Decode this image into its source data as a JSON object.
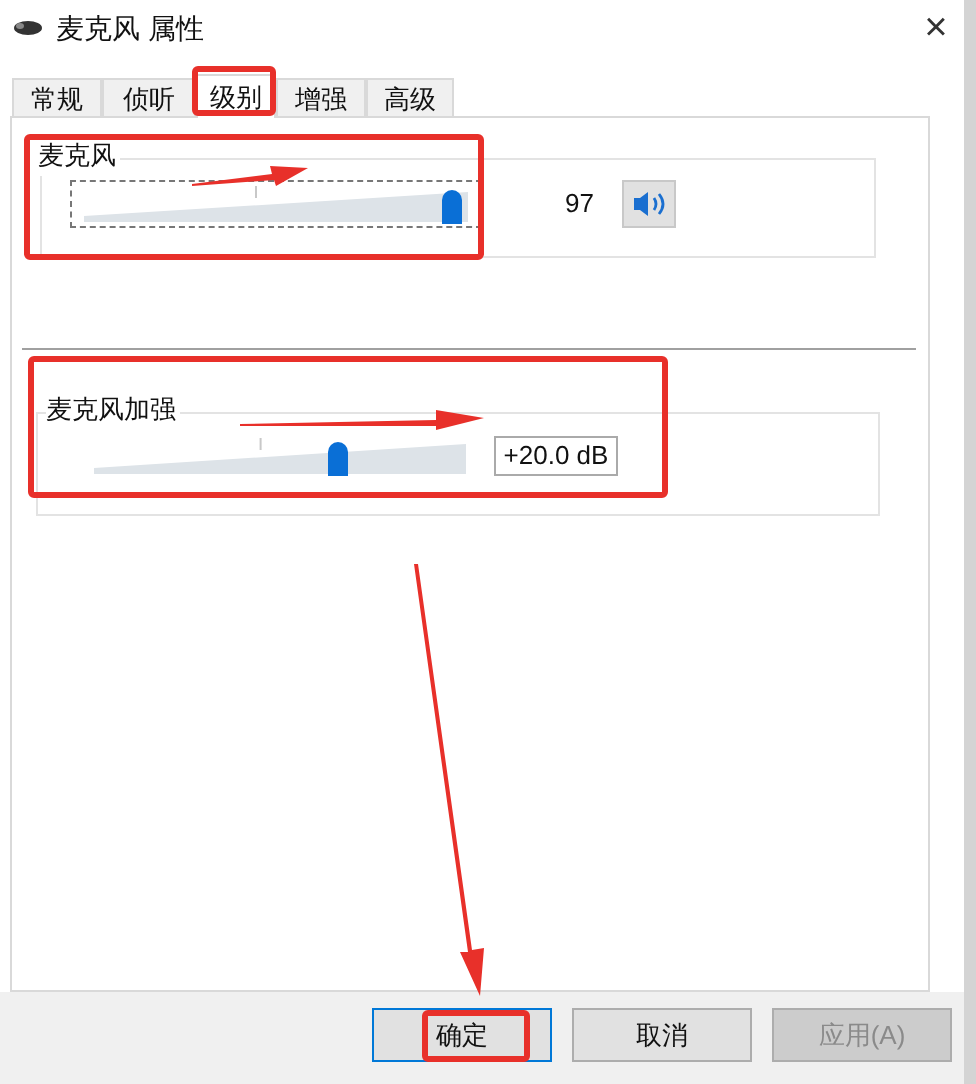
{
  "window": {
    "title": "麦克风 属性",
    "close": "×"
  },
  "tabs": [
    {
      "label": "常规",
      "selected": false
    },
    {
      "label": "侦听",
      "selected": false
    },
    {
      "label": "级别",
      "selected": true
    },
    {
      "label": "增强",
      "selected": false
    },
    {
      "label": "高级",
      "selected": false
    }
  ],
  "microphone": {
    "label": "麦克风",
    "level": 0.97,
    "reading": "97",
    "muted": false
  },
  "boost": {
    "label": "麦克风加强",
    "level": 0.66,
    "reading": "+20.0 dB"
  },
  "buttons": [
    {
      "label": "确定",
      "kind": "default",
      "disabled": false
    },
    {
      "label": "取消",
      "kind": "normal",
      "disabled": false
    },
    {
      "label": "应用(A)",
      "kind": "normal",
      "disabled": true
    }
  ]
}
